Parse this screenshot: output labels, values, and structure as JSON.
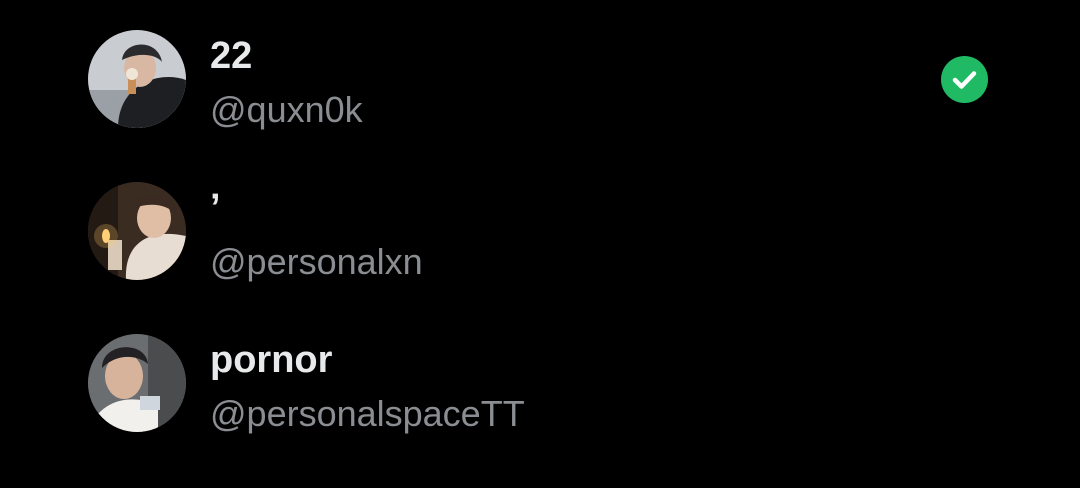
{
  "accounts": [
    {
      "display_name": "22",
      "handle": "@quxn0k",
      "selected": true,
      "avatar": "avatar-photo-ice-cream"
    },
    {
      "display_name": "’",
      "handle": "@personalxn",
      "selected": false,
      "avatar": "avatar-photo-candle"
    },
    {
      "display_name": "pornor",
      "handle": "@personalspaceTT",
      "selected": false,
      "avatar": "avatar-photo-portrait"
    }
  ],
  "icons": {
    "selected_indicator": "check-circle-icon"
  },
  "colors": {
    "background": "#000000",
    "name_text": "#e7e9ea",
    "handle_text": "#8a8d91",
    "selected_check": "#1fba63"
  }
}
